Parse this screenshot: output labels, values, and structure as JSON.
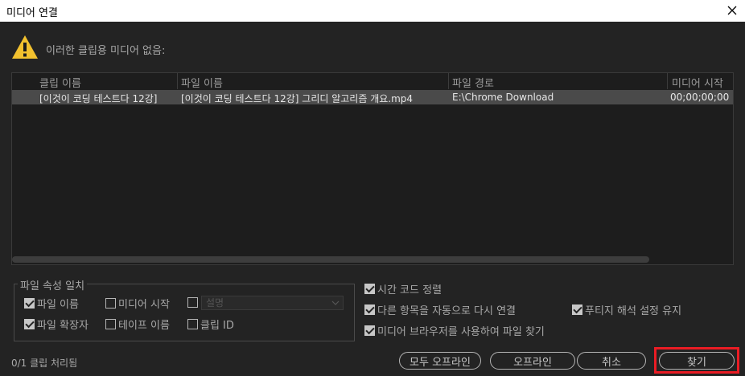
{
  "window": {
    "title": "미디어 연결"
  },
  "warning": {
    "message": "이러한 클립용 미디어 없음:"
  },
  "table": {
    "headers": [
      "클립 이름",
      "파일 이름",
      "파일 경로",
      "미디어 시작"
    ],
    "rows": [
      {
        "clip_name": "[이것이 코딩 테스트다 12강]",
        "file_name": "[이것이 코딩 테스트다 12강] 그리디 알고리즘 개요.mp4",
        "file_path": "E:\\Chrome Download",
        "media_start": "00;00;00;00"
      }
    ]
  },
  "match_group": {
    "label": "파일 속성 일치",
    "file_name": {
      "label": "파일 이름",
      "checked": true
    },
    "media_start": {
      "label": "미디어 시작",
      "checked": false
    },
    "description": {
      "label": "설명",
      "checked": false
    },
    "file_ext": {
      "label": "파일 확장자",
      "checked": true
    },
    "tape_name": {
      "label": "테이프 이름",
      "checked": false
    },
    "clip_id": {
      "label": "클립 ID",
      "checked": false
    }
  },
  "options": {
    "align_timecode": {
      "label": "시간 코드 정렬",
      "checked": true
    },
    "relink_others": {
      "label": "다른 항목을 자동으로 다시 연결",
      "checked": true
    },
    "preserve_interpret": {
      "label": "푸티지 해석 설정 유지",
      "checked": true
    },
    "use_media_browser": {
      "label": "미디어 브라우저를 사용하여 파일 찾기",
      "checked": true
    }
  },
  "status": "0/1 클립 처리됨",
  "buttons": {
    "offline_all": "모두 오프라인",
    "offline": "오프라인",
    "cancel": "취소",
    "locate": "찾기"
  },
  "colors": {
    "accent_highlight": "#ea1c24",
    "warning": "#f2c12e"
  }
}
